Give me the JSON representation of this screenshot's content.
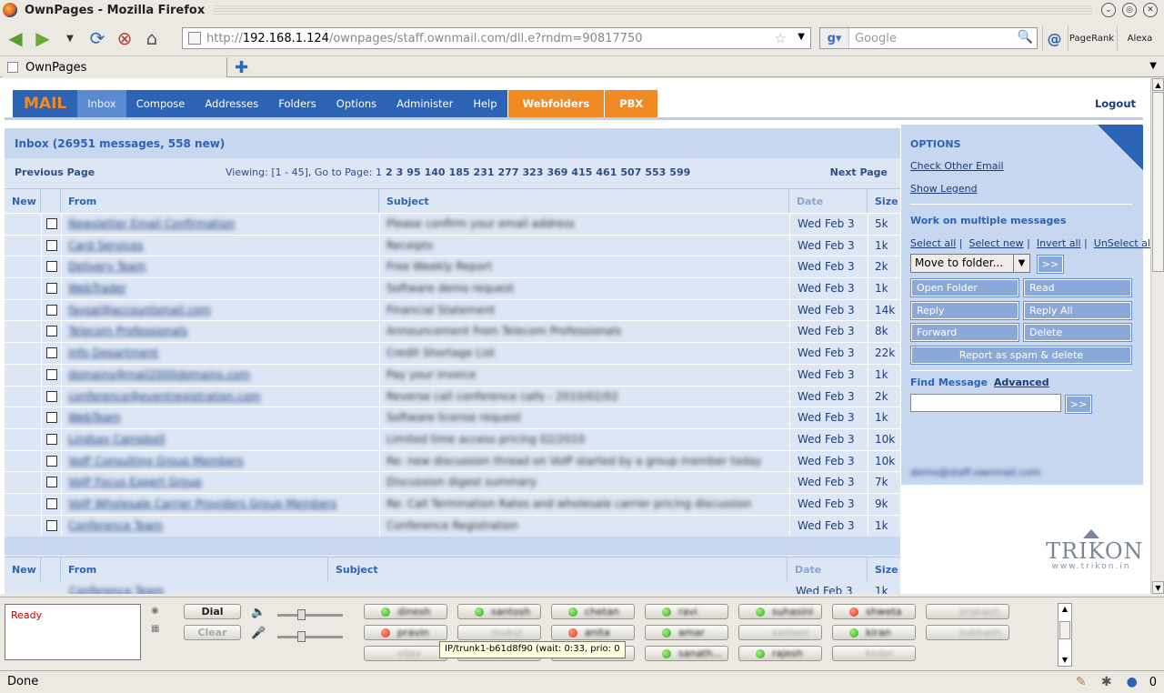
{
  "window": {
    "title": "OwnPages - Mozilla Firefox"
  },
  "browser": {
    "url_proto": "http://",
    "url_host": "192.168.1.124",
    "url_path": "/ownpages/staff.ownmail.com/dll.e?rndm=90817750",
    "search_placeholder": "Google",
    "pagerank_label": "PageRank",
    "alexa_label": "Alexa",
    "tab_title": "OwnPages",
    "status": "Done",
    "status_count": "0"
  },
  "appnav": {
    "mail": "MAIL",
    "items": [
      "Inbox",
      "Compose",
      "Addresses",
      "Folders",
      "Options",
      "Administer",
      "Help"
    ],
    "webfolders": "Webfolders",
    "pbx": "PBX",
    "logout": "Logout"
  },
  "inbox": {
    "title": "Inbox (26951 messages, 558 new)",
    "prev": "Previous Page",
    "next": "Next Page",
    "viewing": "Viewing: [1 - 45], Go to Page: 1",
    "pages": [
      "2",
      "3",
      "95",
      "140",
      "185",
      "231",
      "277",
      "323",
      "369",
      "415",
      "461",
      "507",
      "553",
      "599"
    ],
    "columns": {
      "new": "New",
      "from": "From",
      "subject": "Subject",
      "date": "Date",
      "size": "Size"
    },
    "rows": [
      {
        "from": "Newsletter Email Confirmation",
        "subject": "Please confirm your email address",
        "date": "Wed Feb 3",
        "size": "5k"
      },
      {
        "from": "Card Services",
        "subject": "Receipts",
        "date": "Wed Feb 3",
        "size": "1k"
      },
      {
        "from": "Delivery Team",
        "subject": "Free Weekly Report",
        "date": "Wed Feb 3",
        "size": "2k"
      },
      {
        "from": "WebTrader",
        "subject": "Software demo request",
        "date": "Wed Feb 3",
        "size": "1k"
      },
      {
        "from": "faysal@accountsmail.com",
        "subject": "Financial Statement",
        "date": "Wed Feb 3",
        "size": "14k"
      },
      {
        "from": "Telecom Professionals",
        "subject": "Announcement from Telecom Professionals",
        "date": "Wed Feb 3",
        "size": "8k"
      },
      {
        "from": "Info Department",
        "subject": "Credit Shortage List",
        "date": "Wed Feb 3",
        "size": "22k"
      },
      {
        "from": "domains@mail2000domains.com",
        "subject": "Pay your invoice",
        "date": "Wed Feb 3",
        "size": "1k"
      },
      {
        "from": "conference@eventregistration.com",
        "subject": "Reverse call conference calls - 2010/02/02",
        "date": "Wed Feb 3",
        "size": "2k"
      },
      {
        "from": "WebTeam",
        "subject": "Software license request",
        "date": "Wed Feb 3",
        "size": "1k"
      },
      {
        "from": "Lindsay Campbell",
        "subject": "Limited time access pricing 02/2010",
        "date": "Wed Feb 3",
        "size": "10k"
      },
      {
        "from": "VoIP Consulting Group Members",
        "subject": "Re: new discussion thread on VoIP started by a group member today",
        "date": "Wed Feb 3",
        "size": "10k"
      },
      {
        "from": "VoIP Focus Expert Group",
        "subject": "Discussion digest summary",
        "date": "Wed Feb 3",
        "size": "7k"
      },
      {
        "from": "VoIP Wholesale Carrier Providers Group Members",
        "subject": "Re: Call Termination Rates and wholesale carrier pricing discussion",
        "date": "Wed Feb 3",
        "size": "9k"
      },
      {
        "from": "Conference Team",
        "subject": "Conference Registration",
        "date": "Wed Feb 3",
        "size": "1k"
      }
    ],
    "partial_row": {
      "from": "Conference Team",
      "date": "Wed Feb 3",
      "size": "1k"
    }
  },
  "options": {
    "title": "OPTIONS",
    "check_other": "Check Other Email",
    "show_legend": "Show Legend",
    "multi_title": "Work on multiple messages",
    "select_all": "Select all",
    "select_new": "Select new",
    "invert_all": "Invert all",
    "unselect_all": "UnSelect all",
    "move_folder": "Move to folder...",
    "go": ">>",
    "open_folder": "Open Folder",
    "read": "Read",
    "reply": "Reply",
    "reply_all": "Reply All",
    "forward": "Forward",
    "delete": "Delete",
    "spam": "Report as spam & delete",
    "find_title": "Find Message",
    "advanced": "Advanced",
    "user_email": "demo@staff.ownmail.com"
  },
  "logo": {
    "name": "TRIKON",
    "url": "www.trikon.in"
  },
  "phone": {
    "status": "Ready",
    "dial": "Dial",
    "clear": "Clear",
    "tooltip": "IP/trunk1-b61d8f90 (wait: 0:33, prio: 0",
    "extensions_row1": [
      {
        "label": "dinesh",
        "status": "green"
      },
      {
        "label": "santosh",
        "status": "green"
      },
      {
        "label": "chetan",
        "status": "green"
      },
      {
        "label": "ravi",
        "status": "green"
      },
      {
        "label": "suhasini",
        "status": "green"
      },
      {
        "label": "shweta",
        "status": "red"
      },
      {
        "label": "prakash",
        "status": "none"
      }
    ],
    "extensions_row2": [
      {
        "label": "pravin",
        "status": "red"
      },
      {
        "label": "mukul",
        "status": "none"
      },
      {
        "label": "anita",
        "status": "red"
      },
      {
        "label": "amar",
        "status": "green"
      },
      {
        "label": "sameer",
        "status": "none"
      },
      {
        "label": "kiran",
        "status": "green"
      },
      {
        "label": "subhash",
        "status": "none"
      }
    ],
    "extensions_row3": [
      {
        "label": "vijay",
        "status": "none"
      },
      {
        "label": "...",
        "status": "none"
      },
      {
        "label": "ramesh",
        "status": "green"
      },
      {
        "label": "sanath...",
        "status": "green"
      },
      {
        "label": "rajesh",
        "status": "green"
      },
      {
        "label": "kedar",
        "status": "none"
      }
    ]
  }
}
